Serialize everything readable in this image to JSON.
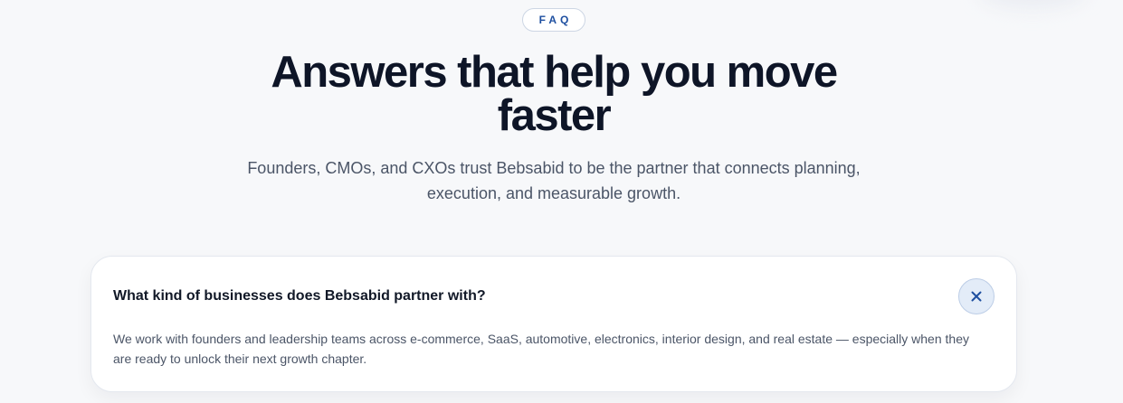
{
  "section": {
    "badge": "FAQ",
    "title": "Answers that help you move faster",
    "subtitle": "Founders, CMOs, and CXOs trust Bebsabid to be the partner that connects planning, execution, and measurable growth."
  },
  "faq": {
    "items": [
      {
        "question": "What kind of businesses does Bebsabid partner with?",
        "answer": "We work with founders and leadership teams across e-commerce, SaaS, automotive, electronics, interior design, and real estate — especially when they are ready to unlock their next growth chapter.",
        "expanded": true,
        "toggle_icon": "close-icon"
      }
    ]
  },
  "colors": {
    "background": "#f7f8fa",
    "accent": "#1e4fa0",
    "heading": "#0e1527",
    "body_text": "#4b5567",
    "toggle_bg": "#e3ecf8"
  }
}
